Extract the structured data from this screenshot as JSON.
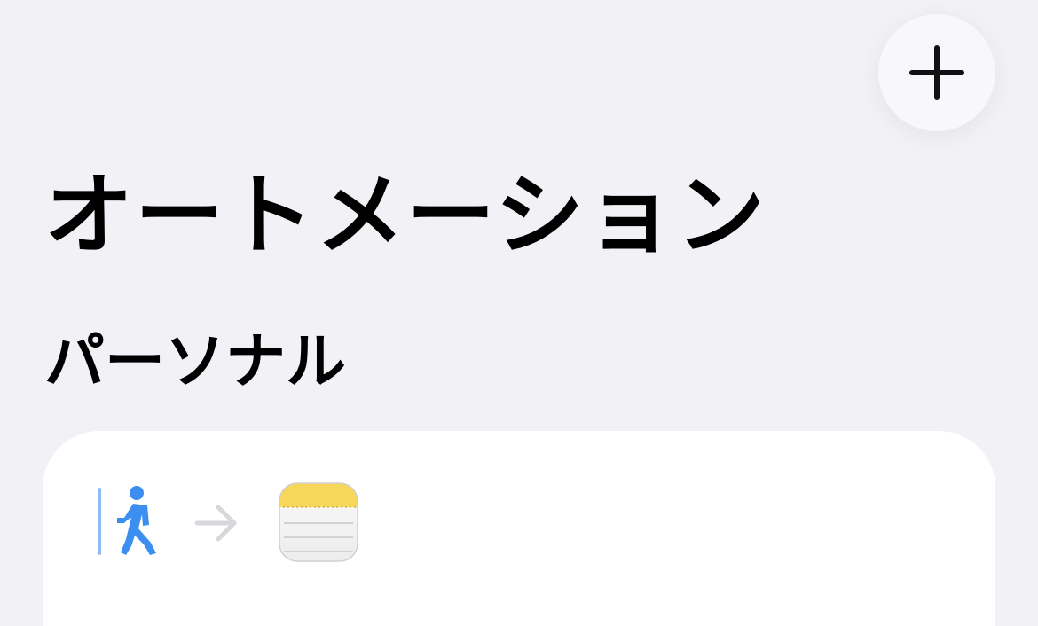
{
  "header": {
    "add_icon": "plus-icon"
  },
  "title": "オートメーション",
  "section": {
    "title": "パーソナル"
  },
  "automation_card": {
    "trigger_icon": "person-leaving-icon",
    "arrow_icon": "arrow-right-icon",
    "action_icon": "notes-app-icon",
    "colors": {
      "trigger": "#3c8ef0",
      "arrow": "#d8d8dc",
      "notes_header": "#f7d75a"
    }
  }
}
